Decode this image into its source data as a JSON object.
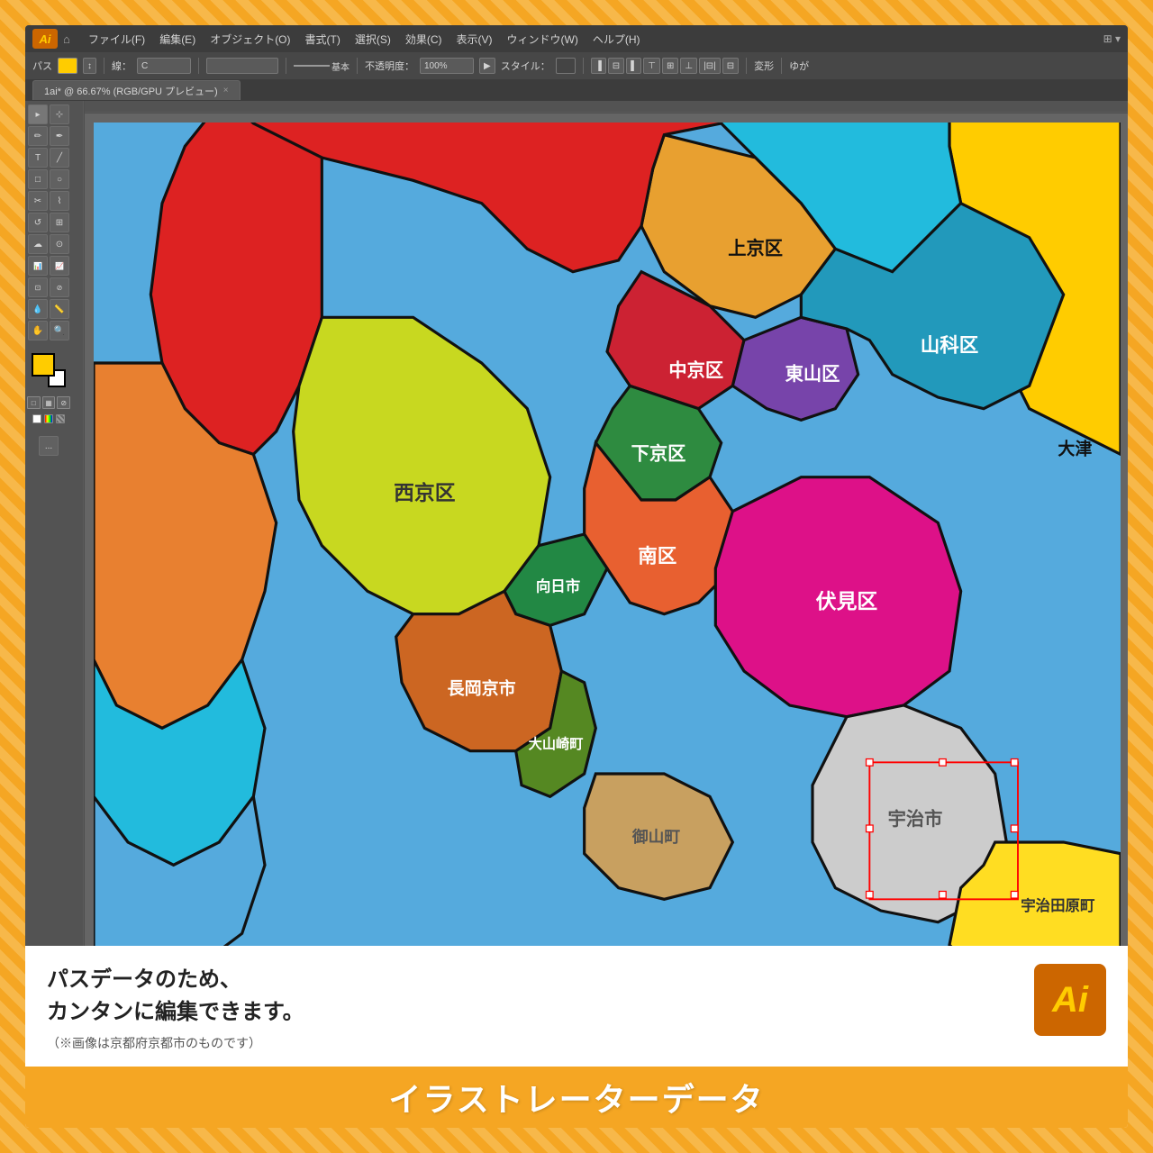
{
  "app": {
    "logo": "Ai",
    "logo_large": "Ai"
  },
  "menu": {
    "items": [
      {
        "label": "ファイル(F)"
      },
      {
        "label": "編集(E)"
      },
      {
        "label": "オブジェクト(O)"
      },
      {
        "label": "書式(T)"
      },
      {
        "label": "選択(S)"
      },
      {
        "label": "効果(C)"
      },
      {
        "label": "表示(V)"
      },
      {
        "label": "ウィンドウ(W)"
      },
      {
        "label": "ヘルプ(H)"
      }
    ]
  },
  "toolbar": {
    "path_label": "パス",
    "stroke_label": "線：",
    "stroke_width": "C",
    "base_label": "基本",
    "opacity_label": "不透明度：",
    "opacity_value": "100%",
    "style_label": "スタイル：",
    "transform_label": "変形",
    "deform_label": "ゆが"
  },
  "tab": {
    "filename": "1ai* @ 66.67% (RGB/GPU プレビュー)",
    "close": "×"
  },
  "map": {
    "regions": [
      {
        "name": "上京区",
        "color": "#e8a030"
      },
      {
        "name": "中京区",
        "color": "#cc2233"
      },
      {
        "name": "下京区",
        "color": "#2e8b40"
      },
      {
        "name": "東山区",
        "color": "#7744aa"
      },
      {
        "name": "山科区",
        "color": "#2299bb"
      },
      {
        "name": "西京区",
        "color": "#c8d820"
      },
      {
        "name": "南区",
        "color": "#e86030"
      },
      {
        "name": "伏見区",
        "color": "#dd1188"
      },
      {
        "name": "向日市",
        "color": "#228844"
      },
      {
        "name": "長岡京市",
        "color": "#cc6622"
      },
      {
        "name": "大山崎町",
        "color": "#558822"
      },
      {
        "name": "大津",
        "color": "#ffcc00"
      },
      {
        "name": "宇治市",
        "color": "#cccccc"
      },
      {
        "name": "御山町",
        "color": "#c8a060"
      },
      {
        "name": "宇治田原町",
        "color": "#ffdd22"
      }
    ]
  },
  "description": {
    "main_line1": "パスデータのため、",
    "main_line2": "カンタンに編集できます。",
    "sub": "（※画像は京都府京都市のものです）"
  },
  "footer": {
    "text": "イラストレーターデータ"
  },
  "tools": [
    "▸",
    "⊹",
    "✏",
    "✒",
    "T",
    "╱",
    "□",
    "○",
    "✂",
    "⌇",
    "↺",
    "⊞",
    "☁",
    "⊙",
    "✋",
    "🔍"
  ]
}
